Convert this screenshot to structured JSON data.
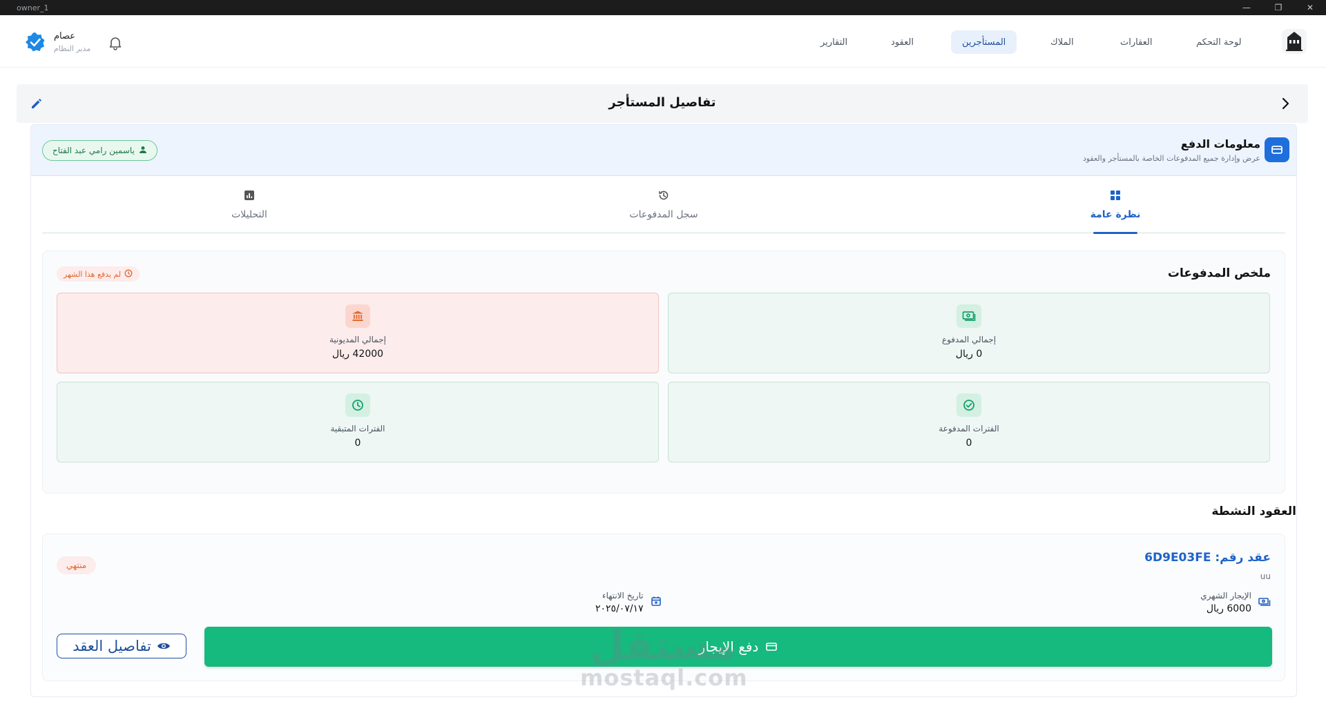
{
  "window": {
    "title": "owner_1"
  },
  "nav": {
    "items": [
      {
        "label": "لوحة التحكم"
      },
      {
        "label": "العقارات"
      },
      {
        "label": "الملاك"
      },
      {
        "label": "المستأجرين"
      },
      {
        "label": "العقود"
      },
      {
        "label": "التقارير"
      }
    ],
    "active_index": 3,
    "user": {
      "name": "عصام",
      "role": "مدير النظام"
    }
  },
  "page": {
    "title": "تفاصيل المستأجر"
  },
  "payment_info": {
    "title": "معلومات الدفع",
    "subtitle": "عرض وإدارة جميع المدفوعات الخاصة بالمستأجر والعقود",
    "tenant_name": "ياسمين رامي عبد الفتاح"
  },
  "tabs": [
    {
      "label": "نظرة عامة",
      "icon": "grid-icon"
    },
    {
      "label": "سجل المدفوعات",
      "icon": "history-icon"
    },
    {
      "label": "التحليلات",
      "icon": "chart-icon"
    }
  ],
  "summary": {
    "title": "ملخص المدفوعات",
    "status_badge": "لم يدفع هذا الشهر",
    "total_paid": {
      "label": "إجمالي المدفوع",
      "value": "0 ريال"
    },
    "total_debt": {
      "label": "إجمالي المديونية",
      "value": "42000 ريال"
    },
    "paid_periods": {
      "label": "الفترات المدفوعة",
      "value": "0"
    },
    "remaining_periods": {
      "label": "الفترات المتبقية",
      "value": "0"
    }
  },
  "active_contracts": {
    "title": "العقود النشطة",
    "contract": {
      "number": "عقد رقم: 6D9E03FE",
      "subtitle": "uu",
      "status": "منتهي",
      "monthly_rent": {
        "label": "الإيجار الشهري",
        "value": "6000 ريال"
      },
      "end_date": {
        "label": "تاريخ الانتهاء",
        "value": "٢٠٢٥/٠٧/١٧"
      },
      "pay_button": "دفع الإيجار",
      "details_button": "تفاصيل العقد"
    }
  },
  "colors": {
    "primary": "#1e63c8",
    "success": "#16b97e",
    "danger_bg": "#fdecec",
    "warning": "#e0682c"
  },
  "watermark": {
    "arabic": "مستقل",
    "latin": "mostaql.com"
  }
}
